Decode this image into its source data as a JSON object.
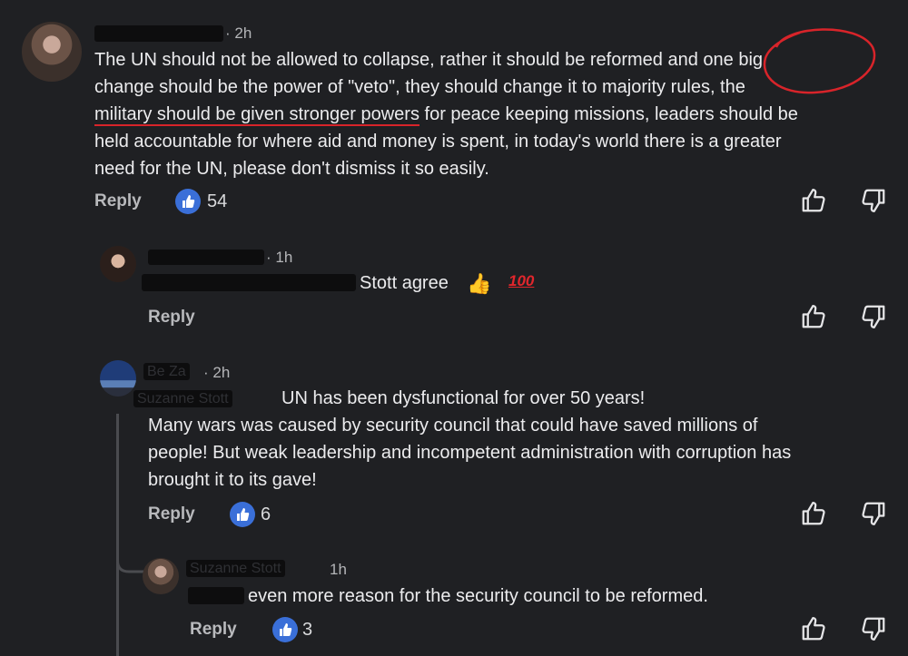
{
  "comments": [
    {
      "time": "· 2h",
      "lines": [
        "The UN should not be allowed to collapse,  rather it should be reformed and one big",
        "change should be the power of \"veto\", they should change it to majority rules, the",
        "for peace keeping missions, leaders should be",
        "held accountable for where aid and money is spent, in today's world there is a greater",
        "need for the UN, please don't dismiss it so easily."
      ],
      "underlined": "military should be given stronger powers",
      "reply": "Reply",
      "likes": "54"
    },
    {
      "time": "· 1h",
      "text": "Stott agree",
      "emoji_hundred": "100",
      "reply": "Reply"
    },
    {
      "name": "Be Za",
      "time": "· 2h",
      "mention": "Suzanne Stott",
      "lines": [
        "UN has been dysfunctional for over 50 years!",
        "Many wars was caused by security council that could have saved millions of",
        "people! But weak leadership and incompetent administration with corruption has",
        "brought it to its gave!"
      ],
      "reply": "Reply",
      "likes": "6"
    },
    {
      "name": "Suzanne Stott",
      "time": "1h",
      "text": "even more reason for the security council to be reformed.",
      "reply": "Reply",
      "likes": "3"
    }
  ],
  "colors": {
    "background": "#1f2023",
    "like_badge": "#3a6fd8",
    "annotation": "#d8242a"
  },
  "icons": [
    "thumb-up-icon",
    "thumb-down-icon",
    "like-badge-icon",
    "thumbs-up-emoji-icon",
    "hundred-emoji-icon"
  ]
}
